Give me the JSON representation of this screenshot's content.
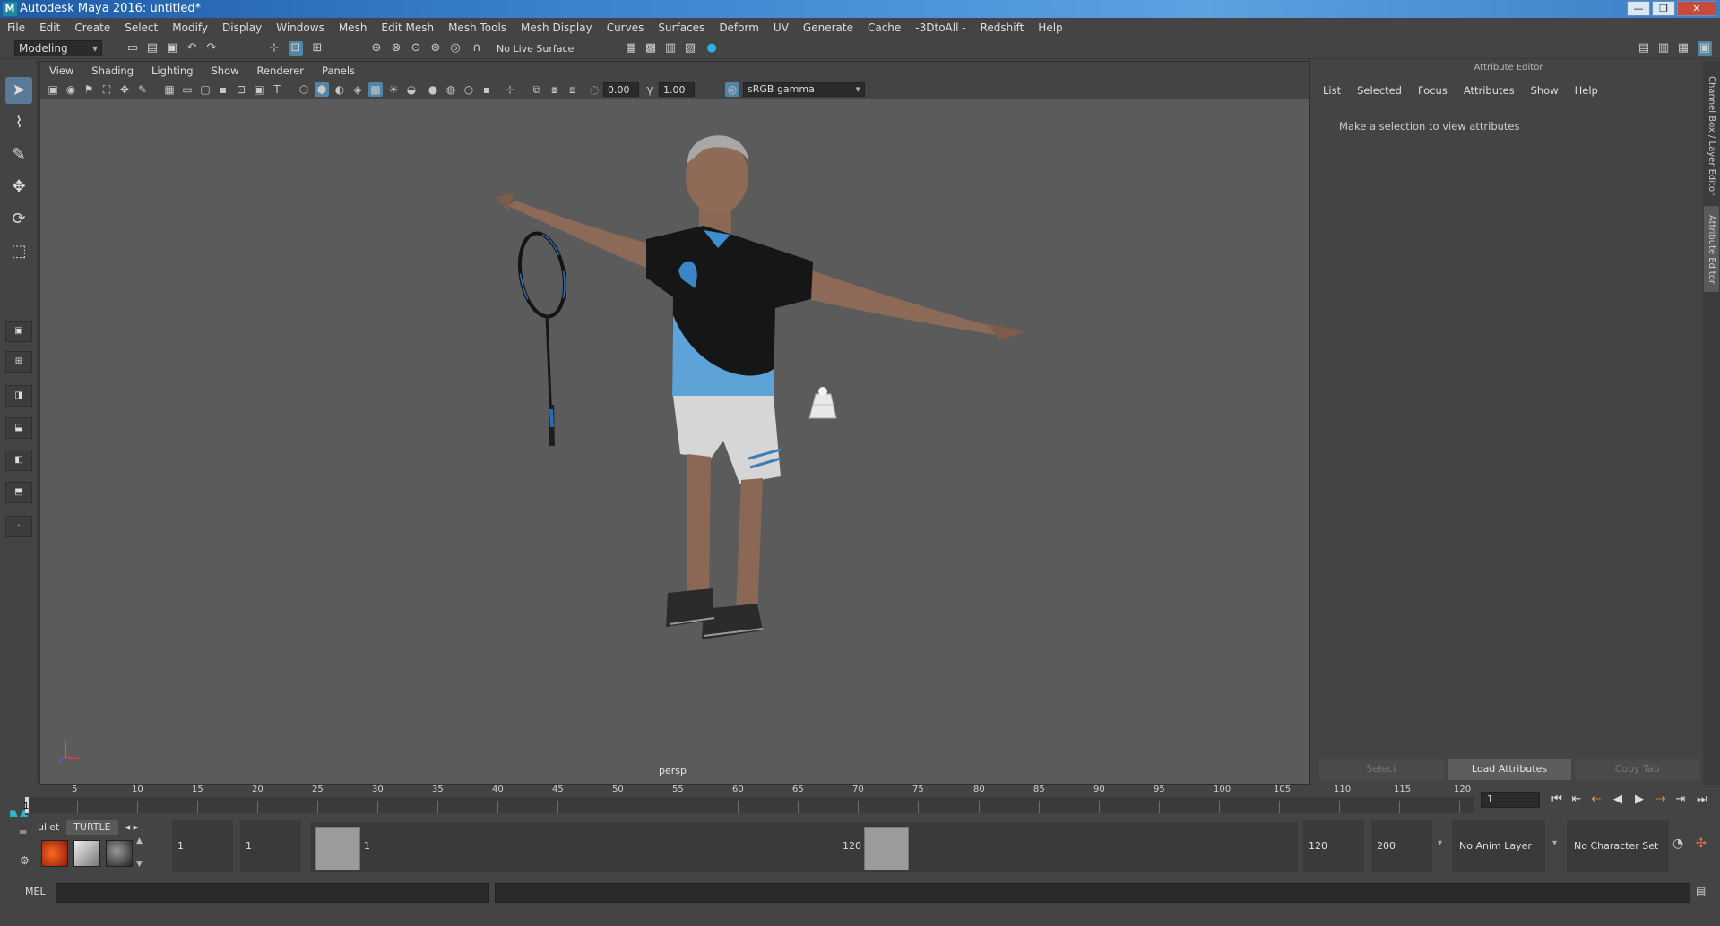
{
  "window": {
    "title": "Autodesk Maya 2016: untitled*",
    "app_icon": "M",
    "buttons": [
      "—",
      "❐",
      "✕"
    ]
  },
  "menubar": [
    "File",
    "Edit",
    "Create",
    "Select",
    "Modify",
    "Display",
    "Windows",
    "Mesh",
    "Edit Mesh",
    "Mesh Tools",
    "Mesh Display",
    "Curves",
    "Surfaces",
    "Deform",
    "UV",
    "Generate",
    "Cache",
    "-3DtoAll -",
    "Redshift",
    "Help"
  ],
  "status": {
    "mode": "Modeling",
    "live_surface": "No Live Surface"
  },
  "panel": {
    "menus": [
      "View",
      "Shading",
      "Lighting",
      "Show",
      "Renderer",
      "Panels"
    ],
    "exposure": "0.00",
    "gamma": "1.00",
    "color_space": "sRGB gamma",
    "camera": "persp"
  },
  "attribute_editor": {
    "title": "Attribute Editor",
    "menus": [
      "List",
      "Selected",
      "Focus",
      "Attributes",
      "Show",
      "Help"
    ],
    "message": "Make a selection to view attributes",
    "buttons": [
      "Select",
      "Load Attributes",
      "Copy Tab"
    ]
  },
  "side_tabs": [
    "Channel Box / Layer Editor",
    "Attribute Editor"
  ],
  "timeline": {
    "ticks": [
      "5",
      "10",
      "15",
      "20",
      "25",
      "30",
      "35",
      "40",
      "45",
      "50",
      "55",
      "60",
      "65",
      "70",
      "75",
      "80",
      "85",
      "90",
      "95",
      "100",
      "105",
      "110",
      "115",
      "120"
    ],
    "current_frame": "1",
    "frame_field": "1"
  },
  "range": {
    "shelf_tabs": [
      "ullet",
      "TURTLE"
    ],
    "start": "1",
    "playback_start": "1",
    "handle_start": "1",
    "handle_end": "120",
    "playback_end": "120",
    "end": "200",
    "anim_layer": "No Anim Layer",
    "character_set": "No Character Set"
  },
  "command": {
    "label": "MEL"
  }
}
